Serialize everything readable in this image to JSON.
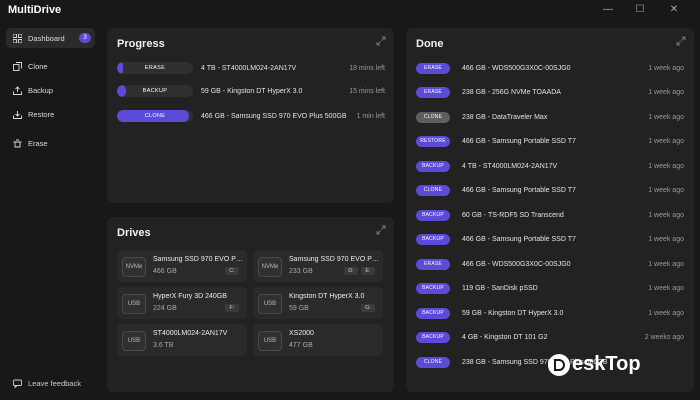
{
  "app": {
    "title": "MultiDrive"
  },
  "window": {
    "minimize": "—",
    "maximize": "☐",
    "close": "✕"
  },
  "sidebar": {
    "items": [
      {
        "label": "Dashboard",
        "icon": "dashboard-icon",
        "badge": "3",
        "active": true
      },
      {
        "label": "Clone",
        "icon": "clone-icon"
      },
      {
        "label": "Backup",
        "icon": "backup-icon"
      },
      {
        "label": "Restore",
        "icon": "restore-icon"
      },
      {
        "label": "Erase",
        "icon": "erase-icon"
      }
    ],
    "feedback": "Leave feedback"
  },
  "progress": {
    "title": "Progress",
    "rows": [
      {
        "op": "ERASE",
        "fraction": 0.08,
        "text": "4 TB - ST4000LM024-2AN17V",
        "time": "18 mins left"
      },
      {
        "op": "BACKUP",
        "fraction": 0.12,
        "text": "59 GB - Kingston DT HyperX 3.0",
        "time": "15 mins left"
      },
      {
        "op": "CLONE",
        "fraction": 0.95,
        "text": "466 GB - Samsung SSD 970 EVO Plus 500GB",
        "time": "1 min left"
      }
    ]
  },
  "drives": {
    "title": "Drives",
    "items": [
      {
        "type": "NVMe",
        "name": "Samsung SSD 970 EVO Pl...",
        "size": "466 GB",
        "letters": [
          "C:"
        ]
      },
      {
        "type": "NVMe",
        "name": "Samsung SSD 970 EVO Pl...",
        "size": "233 GB",
        "letters": [
          "D:",
          "E:"
        ]
      },
      {
        "type": "USB",
        "name": "HyperX Fury 3D 240GB",
        "size": "224 GB",
        "letters": [
          "F:"
        ]
      },
      {
        "type": "USB",
        "name": "Kingston DT HyperX 3.0",
        "size": "59 GB",
        "letters": [
          "G:"
        ]
      },
      {
        "type": "USB",
        "name": "ST4000LM024-2AN17V",
        "size": "3.6 TB",
        "letters": []
      },
      {
        "type": "USB",
        "name": "XS2000",
        "size": "477 GB",
        "letters": []
      }
    ]
  },
  "done": {
    "title": "Done",
    "rows": [
      {
        "op": "ERASE",
        "text": "466 GB - WDS500G3X0C-00SJG0",
        "time": "1 week ago",
        "style": "accent"
      },
      {
        "op": "ERASE",
        "text": "238 GB - 256G NVMe TOAADA",
        "time": "1 week ago",
        "style": "accent"
      },
      {
        "op": "CLONE",
        "text": "238 GB - DataTraveler Max",
        "time": "1 week ago",
        "style": "gray"
      },
      {
        "op": "RESTORE",
        "text": "466 GB - Samsung Portable SSD T7",
        "time": "1 week ago",
        "style": "accent"
      },
      {
        "op": "BACKUP",
        "text": "4 TB - ST4000LM024-2AN17V",
        "time": "1 week ago",
        "style": "accent"
      },
      {
        "op": "CLONE",
        "text": "466 GB - Samsung Portable SSD T7",
        "time": "1 week ago",
        "style": "accent"
      },
      {
        "op": "BACKUP",
        "text": "60 GB - TS-RDF5 SD  Transcend",
        "time": "1 week ago",
        "style": "accent"
      },
      {
        "op": "BACKUP",
        "text": "466 GB - Samsung Portable SSD T7",
        "time": "1 week ago",
        "style": "accent"
      },
      {
        "op": "ERASE",
        "text": "466 GB - WDS500G3X0C-00SJG0",
        "time": "1 week ago",
        "style": "accent"
      },
      {
        "op": "BACKUP",
        "text": "119 GB - SanDisk pSSD",
        "time": "1 week ago",
        "style": "accent"
      },
      {
        "op": "BACKUP",
        "text": "59 GB - Kingston DT HyperX 3.0",
        "time": "1 week ago",
        "style": "accent"
      },
      {
        "op": "BACKUP",
        "text": "4 GB - Kingston DT 101 G2",
        "time": "2 weeks ago",
        "style": "accent"
      },
      {
        "op": "CLONE",
        "text": "238 GB - Samsung SSD 970 EVO Plus 500GB",
        "time": "",
        "style": "accent"
      }
    ]
  },
  "watermark": {
    "text": "eskTop"
  },
  "colors": {
    "accent": "#5b4bd6",
    "panel": "#222222",
    "background": "#181818"
  }
}
